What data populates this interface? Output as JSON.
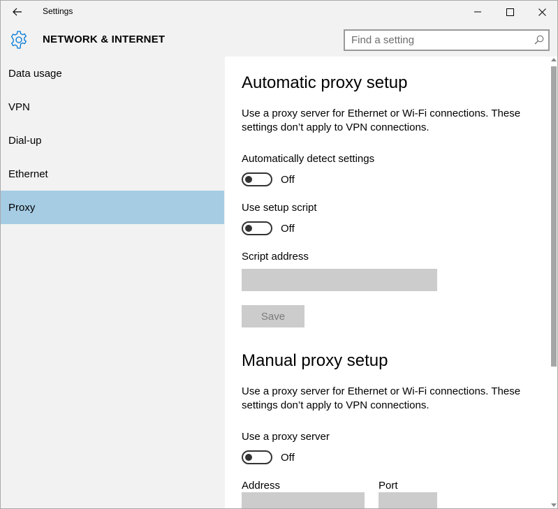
{
  "window": {
    "title": "Settings"
  },
  "header": {
    "section_title": "NETWORK & INTERNET",
    "search_placeholder": "Find a setting"
  },
  "sidebar": {
    "items": [
      {
        "label": "Data usage",
        "selected": false
      },
      {
        "label": "VPN",
        "selected": false
      },
      {
        "label": "Dial-up",
        "selected": false
      },
      {
        "label": "Ethernet",
        "selected": false
      },
      {
        "label": "Proxy",
        "selected": true
      }
    ]
  },
  "automatic": {
    "heading": "Automatic proxy setup",
    "description": "Use a proxy server for Ethernet or Wi-Fi connections. These settings don’t apply to VPN connections.",
    "detect_label": "Automatically detect settings",
    "detect_state": "Off",
    "script_label": "Use setup script",
    "script_state": "Off",
    "address_label": "Script address",
    "address_value": "",
    "save_label": "Save"
  },
  "manual": {
    "heading": "Manual proxy setup",
    "description": "Use a proxy server for Ethernet or Wi-Fi connections. These settings don’t apply to VPN connections.",
    "proxy_label": "Use a proxy server",
    "proxy_state": "Off",
    "address_label": "Address",
    "address_value": "",
    "port_label": "Port",
    "port_value": ""
  },
  "colors": {
    "selected_bg": "#a6cce4",
    "accent": "#0078d7",
    "disabled_field": "#cccccc"
  },
  "icons": {
    "back": "back-arrow-icon",
    "settings": "gear-icon",
    "search": "search-icon",
    "minimize": "minimize-icon",
    "maximize": "maximize-icon",
    "close": "close-icon"
  }
}
